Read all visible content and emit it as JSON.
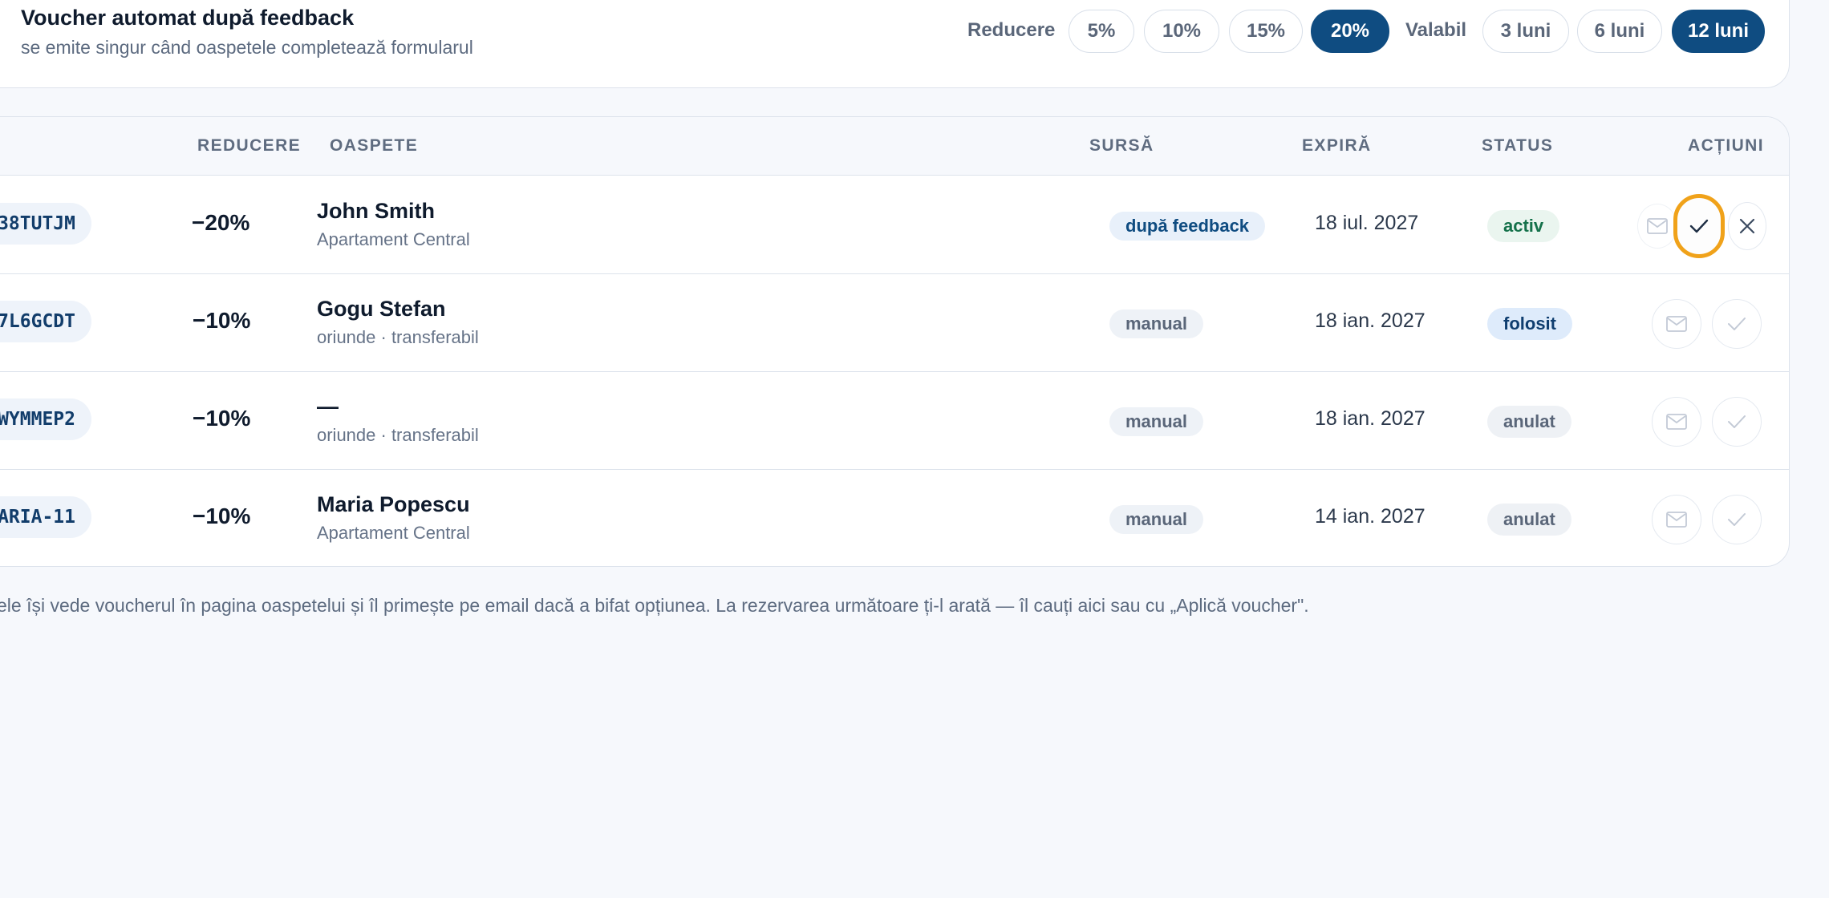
{
  "settings": {
    "title": "Voucher automat după feedback",
    "subtitle": "se emite singur când oaspetele completează formularul",
    "discount_label": "Reducere",
    "discount_options": [
      "5%",
      "10%",
      "15%",
      "20%"
    ],
    "discount_selected": "20%",
    "validity_label": "Valabil",
    "validity_options": [
      "3 luni",
      "6 luni",
      "12 luni"
    ],
    "validity_selected": "12 luni"
  },
  "table": {
    "headers": {
      "discount": "REDUCERE",
      "guest": "OASPETE",
      "source": "SURSĂ",
      "expires": "EXPIRĂ",
      "status": "STATUS",
      "actions": "ACȚIUNI"
    },
    "rows": [
      {
        "code": "38TUTJM",
        "discount": "−20%",
        "guest_name": "John Smith",
        "guest_sub": "Apartament Central",
        "source": "după feedback",
        "expires": "18 iul. 2027",
        "status": "activ"
      },
      {
        "code": "7L6GCDT",
        "discount": "−10%",
        "guest_name": "Gogu Stefan",
        "guest_sub": "oriunde · transferabil",
        "source": "manual",
        "expires": "18 ian. 2027",
        "status": "folosit"
      },
      {
        "code": "WYMMEP2",
        "discount": "−10%",
        "guest_name": "—",
        "guest_sub": "oriunde · transferabil",
        "source": "manual",
        "expires": "18 ian. 2027",
        "status": "anulat"
      },
      {
        "code": "ARIA-11",
        "discount": "−10%",
        "guest_name": "Maria Popescu",
        "guest_sub": "Apartament Central",
        "source": "manual",
        "expires": "14 ian. 2027",
        "status": "anulat"
      }
    ]
  },
  "footer_note": "ele își vede voucherul în pagina oaspetelui și îl primește pe email dacă a bifat opțiunea. La rezervarea următoare ți-l arată — îl cauți aici sau cu „Aplică voucher\".",
  "icons": {
    "email": "mail-icon",
    "use": "check-icon",
    "cancel": "close-icon"
  },
  "colors": {
    "accent": "#0f4c81",
    "focus_ring": "#f0a21a",
    "status_activ": "#14714a",
    "status_folosit": "#0f3e70",
    "status_anulat": "#5a6679"
  }
}
